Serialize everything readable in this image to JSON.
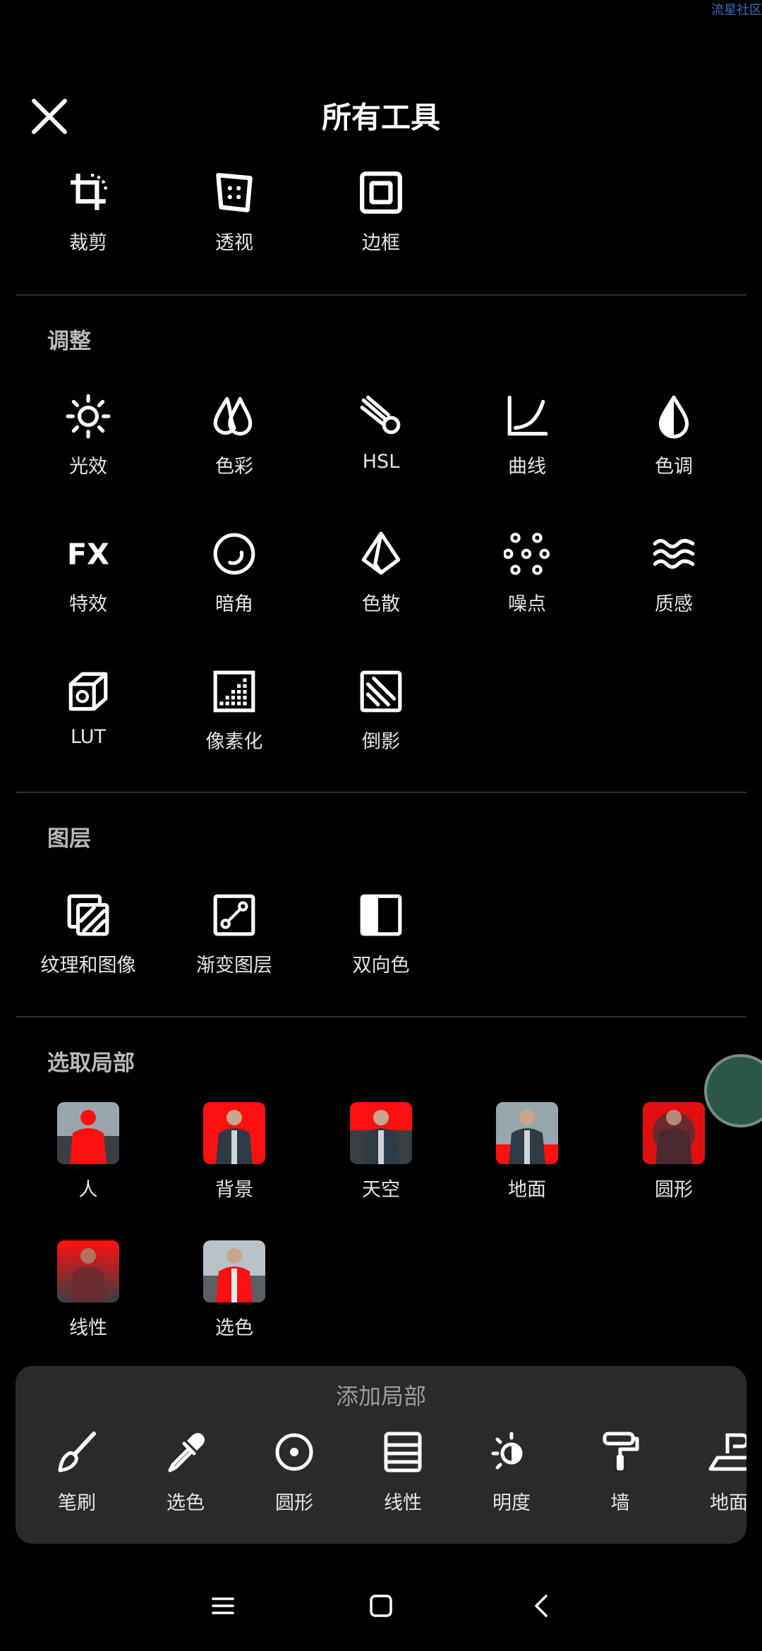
{
  "watermark": "流星社区",
  "header": {
    "title": "所有工具"
  },
  "top_tools": [
    {
      "label": "裁剪",
      "icon": "crop-icon"
    },
    {
      "label": "透视",
      "icon": "perspective-icon"
    },
    {
      "label": "边框",
      "icon": "frame-icon"
    }
  ],
  "adjust": {
    "title": "调整",
    "items": [
      {
        "label": "光效",
        "icon": "sun-icon"
      },
      {
        "label": "色彩",
        "icon": "drops-icon"
      },
      {
        "label": "HSL",
        "icon": "hsl-icon"
      },
      {
        "label": "曲线",
        "icon": "curve-icon"
      },
      {
        "label": "色调",
        "icon": "drop-half-icon"
      },
      {
        "label": "特效",
        "icon": "fx-icon"
      },
      {
        "label": "暗角",
        "icon": "vignette-icon"
      },
      {
        "label": "色散",
        "icon": "prism-icon"
      },
      {
        "label": "噪点",
        "icon": "noise-icon"
      },
      {
        "label": "质感",
        "icon": "waves-icon"
      },
      {
        "label": "LUT",
        "icon": "cube-icon"
      },
      {
        "label": "像素化",
        "icon": "pixelate-icon"
      },
      {
        "label": "倒影",
        "icon": "reflection-icon"
      }
    ]
  },
  "layers": {
    "title": "图层",
    "items": [
      {
        "label": "纹理和图像",
        "icon": "texture-icon"
      },
      {
        "label": "渐变图层",
        "icon": "gradient-icon"
      },
      {
        "label": "双向色",
        "icon": "duotone-icon"
      }
    ]
  },
  "local": {
    "title": "选取局部",
    "items": [
      {
        "label": "人"
      },
      {
        "label": "背景"
      },
      {
        "label": "天空"
      },
      {
        "label": "地面"
      },
      {
        "label": "圆形"
      },
      {
        "label": "线性"
      },
      {
        "label": "选色"
      }
    ]
  },
  "add_local": {
    "title": "添加局部",
    "tools": [
      {
        "label": "笔刷",
        "icon": "brush-icon"
      },
      {
        "label": "选色",
        "icon": "eyedropper-icon"
      },
      {
        "label": "圆形",
        "icon": "circle-target-icon"
      },
      {
        "label": "线性",
        "icon": "linear-icon"
      },
      {
        "label": "明度",
        "icon": "brightness-icon"
      },
      {
        "label": "墙",
        "icon": "paint-roller-icon"
      },
      {
        "label": "地面",
        "icon": "ground-icon"
      }
    ]
  },
  "colors": {
    "accent_red": "#ff1010",
    "panel": "#2a2a2c",
    "fab": "#2c5649"
  }
}
